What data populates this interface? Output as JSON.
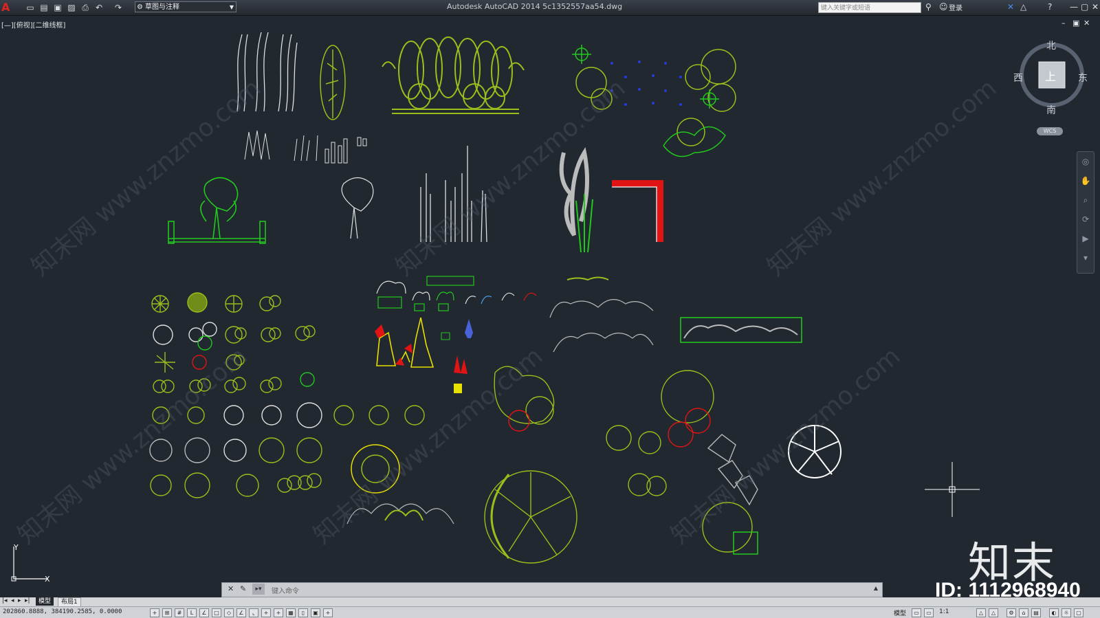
{
  "app": {
    "title": "Autodesk AutoCAD 2014    5c1352557aa54.dwg",
    "workspace": "草图与注释",
    "search_placeholder": "键入关键字或短语",
    "login": "登录"
  },
  "viewport": {
    "label": "[—][俯视][二维线框]"
  },
  "viewcube": {
    "north": "北",
    "south": "南",
    "east": "东",
    "west": "西",
    "top": "上",
    "wcs": "WCS"
  },
  "ucs": {
    "x": "X",
    "y": "Y"
  },
  "command": {
    "placeholder": "键入命令"
  },
  "tabs": {
    "model": "模型",
    "layout1": "布局1"
  },
  "status": {
    "coords": "202860.8888, 384190.2585, 0.0000",
    "model": "模型",
    "scale": "1:1"
  },
  "watermark": {
    "site": "知末网 www.znzmo.com",
    "brand": "知末",
    "id": "ID: 1112968940"
  },
  "colors": {
    "background": "#212830",
    "plant_yellowgreen": "#9abf1c",
    "plant_green": "#22c91d",
    "plant_white": "#e6e6e6",
    "plant_red": "#e01414",
    "plant_yellow": "#e8e000"
  }
}
